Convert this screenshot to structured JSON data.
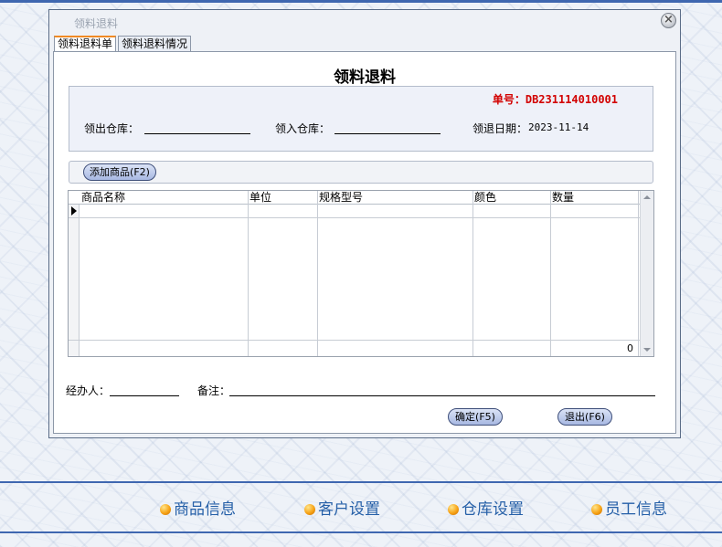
{
  "dialog": {
    "title": "领料退料",
    "tabs": [
      {
        "label": "领料退料单",
        "active": true
      },
      {
        "label": "领料退料情况",
        "active": false
      }
    ],
    "form_title": "领料退料",
    "order_no_label": "单号：",
    "order_no": "DB231114010001",
    "out_warehouse_label": "领出仓库：",
    "out_warehouse_value": "",
    "in_warehouse_label": "领入仓库：",
    "in_warehouse_value": "",
    "date_label": "领退日期：",
    "date_value": "2023-11-14",
    "add_product_label": "添加商品(F2)",
    "grid": {
      "columns": [
        "商品名称",
        "单位",
        "规格型号",
        "颜色",
        "数量"
      ],
      "rows": [],
      "total_quantity": "0"
    },
    "handler_label": "经办人：",
    "handler_value": "",
    "remark_label": "备注：",
    "remark_value": "",
    "confirm_label": "确定(F5)",
    "exit_label": "退出(F6)"
  },
  "nav": [
    {
      "label": "商品信息"
    },
    {
      "label": "客户设置"
    },
    {
      "label": "仓库设置"
    },
    {
      "label": "员工信息"
    }
  ],
  "colors": {
    "accent_blue": "#3f67b0",
    "order_red": "#d20000",
    "nav_text": "#2660a8",
    "tab_active": "#f08a24"
  }
}
